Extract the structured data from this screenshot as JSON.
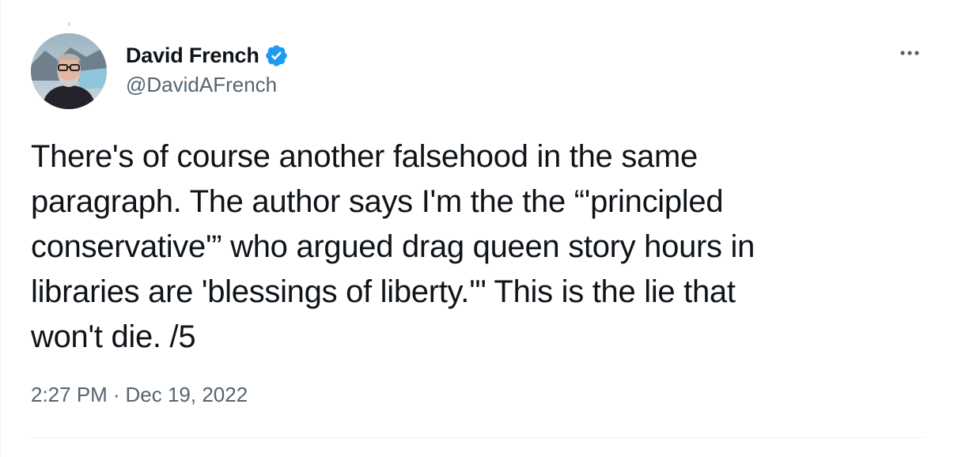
{
  "author": {
    "display_name": "David French",
    "handle": "@DavidAFrench",
    "verified": true,
    "verified_color": "#1d9bf0"
  },
  "tweet": {
    "text": "There's of course another falsehood in the same\nparagraph. The author says I'm the the “'principled\nconservative'” who argued drag queen story hours in\nlibraries are 'blessings of liberty.'\" This is the lie that\nwon't die. /5",
    "time": "2:27 PM",
    "separator": "·",
    "date": "Dec 19, 2022"
  },
  "icons": {
    "more": "more-horizontal-icon",
    "verified": "verified-badge-icon"
  },
  "colors": {
    "text": "#0f1419",
    "secondary": "#536471",
    "divider": "#eff3f4"
  }
}
